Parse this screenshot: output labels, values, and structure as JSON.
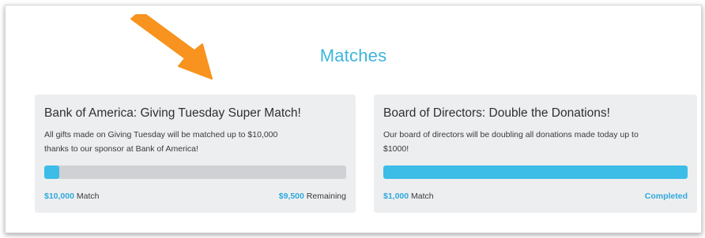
{
  "section": {
    "title": "Matches"
  },
  "matches": [
    {
      "title": "Bank of America: Giving Tuesday Super Match!",
      "description_line1": "All gifts made on Giving Tuesday will be matched up to $10,000",
      "description_line2": "thanks to our sponsor at Bank of America!",
      "progress": 0.05,
      "match_amount": "$10,000",
      "match_label": "Match",
      "remaining_amount": "$9,500",
      "remaining_label": "Remaining"
    },
    {
      "title": "Board of Directors: Double the Donations!",
      "description_line1": "Our board of directors will be doubling all donations made today up to",
      "description_line2": "$1000!",
      "progress": 1.0,
      "match_amount": "$1,000",
      "match_label": "Match",
      "status": "Completed"
    }
  ],
  "colors": {
    "accent": "#3bbde8",
    "title": "#3fb5dc",
    "arrow": "#f7931e",
    "card_bg": "#edeef0",
    "track": "#cfd1d5"
  },
  "icons": {
    "pointer": "arrow-icon"
  }
}
